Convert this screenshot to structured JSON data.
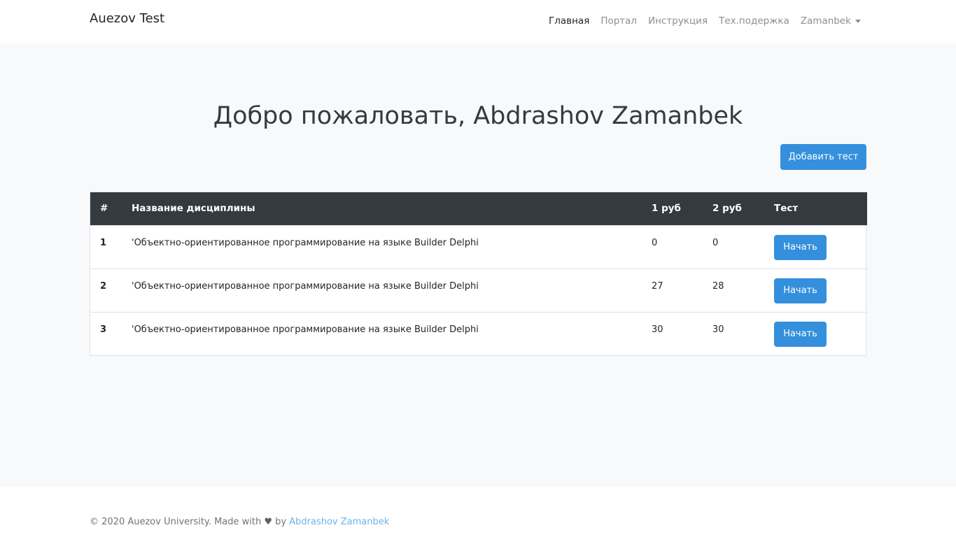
{
  "navbar": {
    "brand": "Auezov Test",
    "items": [
      {
        "label": "Главная",
        "active": true
      },
      {
        "label": "Портал",
        "active": false
      },
      {
        "label": "Инструкция",
        "active": false
      },
      {
        "label": "Тех.подержка",
        "active": false
      }
    ],
    "user": "Zamanbek"
  },
  "main": {
    "title": "Добро пожаловать, Abdrashov Zamanbek",
    "add_button": "Добавить тест"
  },
  "table": {
    "headers": [
      "#",
      "Название дисциплины",
      "1 руб",
      "2 руб",
      "Тест"
    ],
    "rows": [
      {
        "num": "1",
        "name": "'Объектно-ориентированное программирование на языке Builder Delphi",
        "r1": "0",
        "r2": "0",
        "action": "Начать"
      },
      {
        "num": "2",
        "name": "'Объектно-ориентированное программирование на языке Builder Delphi",
        "r1": "27",
        "r2": "28",
        "action": "Начать"
      },
      {
        "num": "3",
        "name": "'Объектно-ориентированное программирование на языке Builder Delphi",
        "r1": "30",
        "r2": "30",
        "action": "Начать"
      }
    ]
  },
  "footer": {
    "prefix": "© 2020 Auezov University. Made with",
    "heart_icon": "heart-icon",
    "by": "by",
    "author": "Abdrashov Zamanbek"
  },
  "colors": {
    "primary": "#3490dc",
    "table_header": "#343a40",
    "link": "#6cb2eb"
  }
}
